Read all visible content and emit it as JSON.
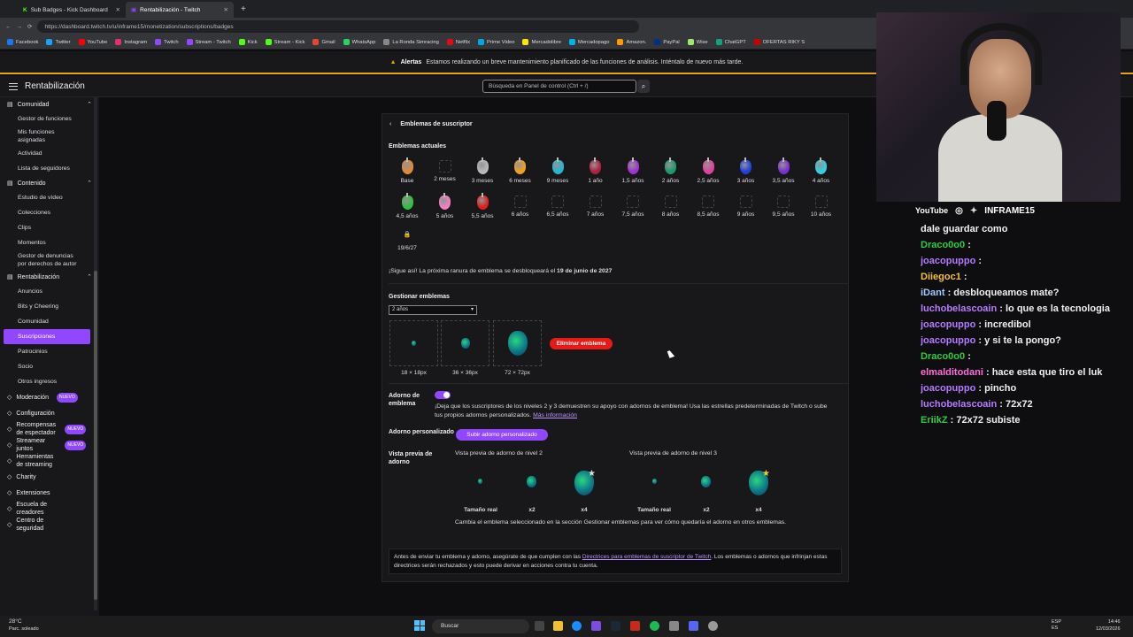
{
  "browser": {
    "tabs": [
      {
        "label": "Sub Badges - Kick Dashboard",
        "active": false
      },
      {
        "label": "Rentabilización - Twitch",
        "active": true
      }
    ],
    "url": "https://dashboard.twitch.tv/u/inframe15/monetization/subscriptions/badges",
    "bookmarks": [
      "Facebook",
      "Twitter",
      "YouTube",
      "Instagram",
      "Twitch",
      "Stream - Twitch",
      "Kick",
      "Stream - Kick",
      "Gmail",
      "WhatsApp",
      "La Ronda Simracing",
      "Netflix",
      "Prime Video",
      "Mercadolibre",
      "Mercadopago",
      "Amazon.",
      "PayPal",
      "Wise",
      "ChatGPT",
      "OFERTAS RIKY S"
    ]
  },
  "alert": {
    "label": "Alertas",
    "text": "Estamos realizando un breve mantenimiento planificado de las funciones de análisis. Inténtalo de nuevo más tarde."
  },
  "topnav": {
    "title": "Rentabilización",
    "search_placeholder": "Búsqueda en Panel de control (Ctrl + /)"
  },
  "sidebar": {
    "sections": [
      {
        "label": "Comunidad",
        "items": [
          "Gestor de funciones",
          "Mis funciones asignadas",
          "Actividad",
          "Lista de seguidores"
        ]
      },
      {
        "label": "Contenido",
        "items": [
          "Estudio de vídeo",
          "Colecciones",
          "Clips",
          "Momentos",
          "Gestor de denuncias por derechos de autor"
        ]
      },
      {
        "label": "Rentabilización",
        "items": [
          "Anuncios",
          "Bits y Cheering",
          "Comunidad",
          "Suscripciones",
          "Patrocinios",
          "Socio",
          "Otros ingresos"
        ]
      }
    ],
    "active": "Suscripciones",
    "bottom": [
      {
        "label": "Moderación",
        "badge": "NUEVO"
      },
      {
        "label": "Configuración",
        "badge": ""
      },
      {
        "label": "Recompensas de espectador",
        "badge": "NUEVO"
      },
      {
        "label": "Streamear juntos",
        "badge": "NUEVO"
      },
      {
        "label": "Herramientas de streaming",
        "badge": ""
      },
      {
        "label": "Charity",
        "badge": ""
      },
      {
        "label": "Extensiones",
        "badge": ""
      },
      {
        "label": "Escuela de creadores",
        "badge": ""
      },
      {
        "label": "Centro de seguridad",
        "badge": ""
      }
    ]
  },
  "panel": {
    "title": "Emblemas de suscriptor",
    "current_header": "Emblemas actuales",
    "badges": [
      {
        "label": "Base",
        "color": "#e08a3a"
      },
      {
        "label": "2 meses",
        "color": ""
      },
      {
        "label": "3 meses",
        "color": "#b8b8b8"
      },
      {
        "label": "6 meses",
        "color": "#f0a020"
      },
      {
        "label": "9 meses",
        "color": "#20b8d0"
      },
      {
        "label": "1 año",
        "color": "#b02040"
      },
      {
        "label": "1,5 años",
        "color": "#a030d0"
      },
      {
        "label": "2 años",
        "color": "#1a9a6a"
      },
      {
        "label": "2,5 años",
        "color": "#e0409a"
      },
      {
        "label": "3 años",
        "color": "#2040e0"
      },
      {
        "label": "3,5 años",
        "color": "#7a30d0"
      },
      {
        "label": "4 años",
        "color": "#30d0e0"
      },
      {
        "label": "4,5 años",
        "color": "#30c040"
      },
      {
        "label": "5 años",
        "color": "#f080c0"
      },
      {
        "label": "5,5 años",
        "color": "#e02020"
      },
      {
        "label": "6 años",
        "color": ""
      },
      {
        "label": "6,5 años",
        "color": ""
      },
      {
        "label": "7 años",
        "color": ""
      },
      {
        "label": "7,5 años",
        "color": ""
      },
      {
        "label": "8 años",
        "color": ""
      },
      {
        "label": "8,5 años",
        "color": ""
      },
      {
        "label": "9 años",
        "color": ""
      },
      {
        "label": "9,5 años",
        "color": ""
      },
      {
        "label": "10 años",
        "color": ""
      },
      {
        "label": "19/6/27",
        "color": "lock"
      }
    ],
    "unlock_msg": "¡Sigue así! La próxima ranura de emblema se desbloqueará el",
    "unlock_date": "19 de junio de 2027",
    "manage_header": "Gestionar emblemas",
    "select_value": "2 años",
    "sizes": [
      "18 × 18px",
      "36 × 36px",
      "72 × 72px"
    ],
    "delete_btn": "Eliminar emblema",
    "adorn_label": "Adorno de emblema",
    "adorn_text": "¡Deja que los suscriptores de los niveles 2 y 3 demuestren su apoyo con adornos de emblema! Usa las estrellas predeterminadas de Twitch o sube tus propios adornos personalizados.",
    "more_info": "Más información",
    "custom_label": "Adorno personalizado",
    "upload_btn": "Subir adorno personalizado",
    "preview_label": "Vista previa de adorno",
    "tier2": "Vista previa de adorno de nivel 2",
    "tier3": "Vista previa de adorno de nivel 3",
    "preview_sizes": [
      "Tamaño real",
      "x2",
      "x4"
    ],
    "preview_note": "Cambia el emblema seleccionado en la sección Gestionar emblemas para ver cómo quedaría el adorno en otros emblemas.",
    "notice_pre": "Antes de enviar tu emblema y adorno, asegúrate de que cumplen con las",
    "notice_link": "Directrices para emblemas de suscriptor de Twitch",
    "notice_post": ". Los emblemas o adornos que infrinjan estas directrices serán rechazados y esto puede derivar en acciones contra tu cuenta."
  },
  "overlay": {
    "socials": [
      "YouTube",
      "INFRAME15"
    ],
    "chat": [
      {
        "user": "",
        "msg": "dale guardar como",
        "color": "#dedee3"
      },
      {
        "user": "Draco0o0",
        "msg": ": ",
        "color": "#2ecc40"
      },
      {
        "user": "joacopuppo",
        "msg": ": ",
        "color": "#b57bff"
      },
      {
        "user": "Diiegoc1",
        "msg": ": ",
        "color": "#f0c040"
      },
      {
        "user": "iDant",
        "msg": ": desbloqueamos mate?",
        "color": "#9ecbff"
      },
      {
        "user": "luchobelascoain",
        "msg": ": lo que es la tecnologia",
        "color": "#b57bff"
      },
      {
        "user": "joacopuppo",
        "msg": ": incredibol",
        "color": "#b57bff"
      },
      {
        "user": "joacopuppo",
        "msg": ": y si te la pongo?",
        "color": "#b57bff"
      },
      {
        "user": "Draco0o0",
        "msg": ":",
        "color": "#2ecc40"
      },
      {
        "user": "elmalditodani",
        "msg": ": hace esta que tiro el luk",
        "color": "#ff6fd8"
      },
      {
        "user": "joacopuppo",
        "msg": ": pincho",
        "color": "#b57bff"
      },
      {
        "user": "luchobelascoain",
        "msg": ": 72x72",
        "color": "#b57bff"
      },
      {
        "user": "EriikZ",
        "msg": ": 72x72 subiste",
        "color": "#2ecc40"
      }
    ]
  },
  "taskbar": {
    "weather_temp": "28°C",
    "weather_desc": "Parc. soleado",
    "search": "Buscar",
    "lang": "ESP ES",
    "time": "14:46",
    "date": "12/03/2026"
  }
}
